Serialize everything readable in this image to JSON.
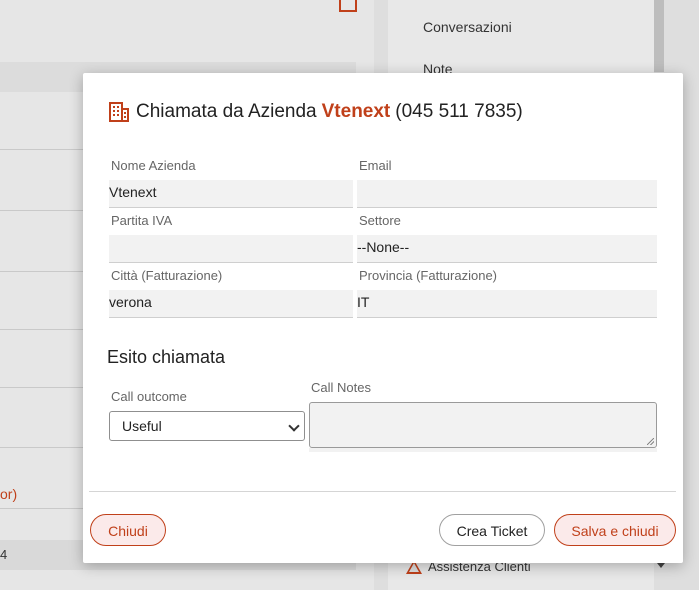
{
  "background": {
    "right_panel_items": [
      "Conversazioni",
      "Note"
    ],
    "left_partial_text": "or)",
    "left_partial_number": "4",
    "bottom_item": "Assistenza Clienti"
  },
  "modal": {
    "title_prefix": "Chiamata da Azienda",
    "company_name": "Vtenext",
    "phone": "(045 511 7835)",
    "fields": {
      "company_label": "Nome Azienda",
      "company_value": "Vtenext",
      "email_label": "Email",
      "email_value": "",
      "vat_label": "Partita IVA",
      "vat_value": "",
      "sector_label": "Settore",
      "sector_value": "--None--",
      "city_label": "Città (Fatturazione)",
      "city_value": "verona",
      "province_label": "Provincia (Fatturazione)",
      "province_value": "IT"
    },
    "outcome_section_title": "Esito chiamata",
    "call_outcome_label": "Call outcome",
    "call_outcome_selected": "Useful",
    "call_notes_label": "Call Notes",
    "call_notes_value": "",
    "buttons": {
      "close": "Chiudi",
      "create_ticket": "Crea Ticket",
      "save_close": "Salva e chiudi"
    }
  },
  "colors": {
    "accent": "#c0401a",
    "button_bg": "#fbeaea",
    "field_bg": "#f2f2f2"
  },
  "icons": {
    "title_icon": "building-icon",
    "bottom_icon": "warning-icon"
  }
}
